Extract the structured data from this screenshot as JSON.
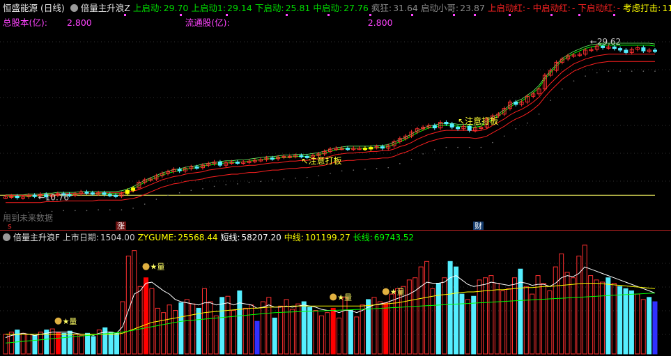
{
  "header": {
    "stock_name": "恒盛能源",
    "period": "(日线)",
    "indicator_name": "倍量主升浪Z",
    "metrics": [
      {
        "label": "上启动:",
        "value": "29.70",
        "color": "#00dd00"
      },
      {
        "label": "上启动1:",
        "value": "29.14",
        "color": "#00dd00"
      },
      {
        "label": "下启动:",
        "value": "25.81",
        "color": "#00dd00"
      },
      {
        "label": "中启动:",
        "value": "27.76",
        "color": "#00dd00"
      },
      {
        "label": "疯狂:",
        "value": "31.64",
        "color": "#8a8a8a"
      },
      {
        "label": "启动小哥:",
        "value": "23.87",
        "color": "#8a8a8a"
      },
      {
        "label": "上启动红:",
        "value": "-",
        "color": "#ff2222"
      },
      {
        "label": "中启动红:",
        "value": "-",
        "color": "#ff2222"
      },
      {
        "label": "下启动红:",
        "value": "-",
        "color": "#ff2222"
      },
      {
        "label": "考虑打击:",
        "value": "11.71",
        "color": "#ffff00"
      }
    ],
    "end_glyph": "◇"
  },
  "info": {
    "total_shares_label": "总股本(亿):",
    "total_shares_value": "2.800",
    "float_shares_label": "流通股(亿):",
    "float_shares_value": "2.800"
  },
  "price_annotations": {
    "high_label": "29.62",
    "low_label": "10.76",
    "signal_1": "注意打板",
    "signal_2": "注意打板",
    "future_data": "用到未来数据",
    "marker_s": "s",
    "marker_zhang": "涨",
    "marker_cai": "财"
  },
  "indicator": {
    "name": "倍量主升浪F",
    "items": [
      {
        "label": "上市日期:",
        "value": "1504.00",
        "color": "#cccccc"
      },
      {
        "label": "ZYGUME:",
        "value": "25568.44",
        "color": "#ffff00"
      },
      {
        "label": "短线:",
        "value": "58207.20",
        "color": "#ffffff"
      },
      {
        "label": "中线:",
        "value": "101199.27",
        "color": "#ffff00"
      },
      {
        "label": "长线:",
        "value": "69743.52",
        "color": "#00ff00"
      }
    ],
    "star_label": "★量"
  },
  "colors": {
    "up": "#ff3030",
    "down": "#55eeff",
    "ma_green": "#00ff00",
    "ma_red": "#ff2020",
    "hline": "#ffff66",
    "big_up": "#ffff00"
  },
  "chart_data": [
    {
      "type": "candlestick",
      "title": "恒盛能源 (日线)",
      "ylim": [
        9.5,
        31.5
      ],
      "hline": 11.2,
      "price_high": 29.62,
      "price_low": 10.76,
      "series": {
        "close": [
          11.0,
          11.1,
          10.9,
          11.0,
          11.2,
          11.1,
          11.3,
          11.0,
          11.2,
          11.4,
          11.3,
          11.2,
          11.4,
          11.6,
          11.5,
          11.4,
          11.5,
          11.3,
          11.2,
          11.1,
          11.4,
          11.8,
          12.1,
          12.8,
          13.1,
          13.2,
          13.6,
          13.9,
          14.1,
          14.4,
          14.2,
          14.5,
          14.7,
          14.6,
          14.9,
          15.1,
          15.3,
          14.9,
          15.2,
          15.3,
          15.2,
          15.3,
          15.4,
          15.5,
          15.6,
          15.8,
          15.7,
          15.9,
          16.0,
          16.0,
          16.1,
          16.0,
          15.9,
          16.1,
          16.3,
          16.6,
          16.9,
          17.0,
          17.0,
          16.9,
          17.0,
          17.0,
          16.9,
          17.1,
          17.2,
          17.0,
          17.3,
          17.8,
          18.2,
          18.5,
          19.0,
          19.4,
          19.6,
          19.8,
          19.5,
          20.2,
          20.0,
          19.6,
          19.4,
          19.7,
          19.2,
          19.5,
          19.6,
          20.6,
          21.0,
          21.2,
          21.9,
          22.7,
          22.4,
          22.7,
          23.4,
          23.7,
          24.3,
          26.0,
          26.6,
          27.6,
          28.0,
          28.4,
          28.5,
          28.6,
          29.1,
          29.2,
          29.6,
          29.4,
          29.5,
          29.3,
          29.1,
          28.8,
          29.2,
          29.4,
          29.0,
          29.1,
          29.0
        ],
        "ma_green_1": [
          11.0,
          11.0,
          11.0,
          11.0,
          11.1,
          11.1,
          11.1,
          11.2,
          11.2,
          11.3,
          11.3,
          11.3,
          11.3,
          11.4,
          11.4,
          11.4,
          11.4,
          11.4,
          11.4,
          11.4,
          11.5,
          11.7,
          12.0,
          12.4,
          12.8,
          13.1,
          13.4,
          13.7,
          13.9,
          14.1,
          14.2,
          14.4,
          14.5,
          14.6,
          14.8,
          14.9,
          15.0,
          15.1,
          15.2,
          15.2,
          15.3,
          15.3,
          15.4,
          15.5,
          15.6,
          15.7,
          15.7,
          15.8,
          15.9,
          15.9,
          16.0,
          16.0,
          16.0,
          16.1,
          16.2,
          16.4,
          16.6,
          16.8,
          16.9,
          17.0,
          17.0,
          17.0,
          17.0,
          17.0,
          17.1,
          17.1,
          17.2,
          17.5,
          17.8,
          18.1,
          18.5,
          18.9,
          19.2,
          19.5,
          19.6,
          19.8,
          19.8,
          19.8,
          19.7,
          19.7,
          19.6,
          19.6,
          19.7,
          20.1,
          20.6,
          21.0,
          21.5,
          22.1,
          22.5,
          22.8,
          23.3,
          23.8,
          24.5,
          25.5,
          26.3,
          27.1,
          27.8,
          28.3,
          28.7,
          29.0,
          29.3,
          29.5,
          29.6,
          29.7,
          29.7,
          29.7,
          29.7,
          29.7,
          29.7,
          29.7,
          29.7,
          29.7,
          29.6
        ],
        "ma_red_low": [
          10.3,
          10.3,
          10.3,
          10.3,
          10.3,
          10.3,
          10.3,
          10.4,
          10.4,
          10.4,
          10.5,
          10.5,
          10.5,
          10.5,
          10.5,
          10.5,
          10.6,
          10.6,
          10.6,
          10.6,
          10.6,
          10.7,
          10.8,
          11.0,
          11.3,
          11.6,
          11.9,
          12.2,
          12.4,
          12.6,
          12.7,
          12.9,
          13.0,
          13.1,
          13.2,
          13.4,
          13.5,
          13.6,
          13.7,
          13.8,
          13.8,
          13.9,
          14.0,
          14.0,
          14.1,
          14.2,
          14.3,
          14.3,
          14.4,
          14.5,
          14.5,
          14.6,
          14.6,
          14.7,
          14.8,
          14.9,
          15.1,
          15.3,
          15.4,
          15.5,
          15.5,
          15.6,
          15.6,
          15.7,
          15.7,
          15.8,
          15.8,
          16.0,
          16.3,
          16.5,
          16.8,
          17.2,
          17.5,
          17.8,
          18.0,
          18.2,
          18.3,
          18.3,
          18.3,
          18.3,
          18.3,
          18.2,
          18.3,
          18.5,
          18.9,
          19.3,
          19.7,
          20.2,
          20.6,
          20.9,
          21.3,
          21.8,
          22.4,
          23.3,
          24.1,
          24.8,
          25.5,
          26.0,
          26.5,
          26.8,
          27.1,
          27.3,
          27.5,
          27.6,
          27.7,
          27.7,
          27.7,
          27.7,
          27.7,
          27.7,
          27.7,
          27.7,
          27.7
        ]
      }
    },
    {
      "type": "bar",
      "title": "倍量主升浪F",
      "ylim": [
        0,
        101199.27
      ],
      "values": [
        18000,
        20000,
        22000,
        19000,
        18000,
        17000,
        20000,
        22000,
        23000,
        20000,
        19000,
        21000,
        18000,
        17000,
        19000,
        16000,
        22000,
        24000,
        20000,
        19000,
        48000,
        90000,
        95000,
        62000,
        70000,
        60000,
        42000,
        38000,
        45000,
        40000,
        47000,
        50000,
        46000,
        42000,
        60000,
        48000,
        35000,
        52000,
        53000,
        40000,
        58000,
        42000,
        45000,
        30000,
        48000,
        52000,
        33000,
        44000,
        50000,
        41000,
        46000,
        48000,
        43000,
        40000,
        35000,
        38000,
        42000,
        33000,
        52000,
        40000,
        34000,
        45000,
        50000,
        52000,
        48000,
        47000,
        55000,
        60000,
        62000,
        68000,
        70000,
        80000,
        85000,
        60000,
        65000,
        70000,
        85000,
        80000,
        55000,
        50000,
        53000,
        68000,
        70000,
        72000,
        65000,
        58000,
        60000,
        70000,
        78000,
        62000,
        55000,
        72000,
        65000,
        58000,
        80000,
        92000,
        75000,
        70000,
        90000,
        100000,
        72000,
        68000,
        66000,
        70000,
        65000,
        62000,
        60000,
        58000,
        55000,
        50000,
        52000,
        48000
      ],
      "short_line": [
        15000,
        17000,
        18000,
        19000,
        18000,
        17000,
        18000,
        19000,
        20000,
        20000,
        20000,
        20000,
        19000,
        18000,
        18000,
        17000,
        19000,
        20000,
        20000,
        19000,
        25000,
        40000,
        55000,
        58000,
        65000,
        66000,
        62000,
        58000,
        55000,
        50000,
        48000,
        47000,
        46000,
        45000,
        47000,
        47000,
        45000,
        46000,
        47000,
        45000,
        47000,
        46000,
        45000,
        42000,
        43000,
        45000,
        43000,
        43000,
        44000,
        43000,
        44000,
        45000,
        44000,
        43000,
        41000,
        40000,
        40000,
        38000,
        40000,
        40000,
        38000,
        40000,
        43000,
        45000,
        46000,
        47000,
        49000,
        51000,
        53000,
        55000,
        58000,
        62000,
        66000,
        65000,
        65000,
        66000,
        70000,
        72000,
        68000,
        64000,
        62000,
        63000,
        64000,
        66000,
        65000,
        64000,
        63000,
        64000,
        66000,
        65000,
        63000,
        64000,
        64000,
        62000,
        65000,
        70000,
        72000,
        71000,
        74000,
        80000,
        78000,
        76000,
        74000,
        72000,
        70000,
        68000,
        66000,
        64000,
        62000,
        60000,
        58000,
        56000
      ],
      "mid_line": [
        18000,
        18000,
        18000,
        18000,
        18000,
        18000,
        18000,
        18000,
        18000,
        18000,
        18000,
        18000,
        18000,
        18000,
        18000,
        18000,
        18000,
        18000,
        18000,
        18000,
        19000,
        21000,
        23000,
        25000,
        27000,
        29000,
        30000,
        31000,
        32000,
        33000,
        34000,
        35000,
        36000,
        37000,
        38000,
        38500,
        39000,
        39500,
        40000,
        40500,
        41000,
        41500,
        42000,
        42000,
        42500,
        43000,
        43000,
        43500,
        43500,
        44000,
        44000,
        44000,
        44000,
        44000,
        44000,
        44000,
        44000,
        44000,
        44000,
        44000,
        44000,
        44000,
        44500,
        45000,
        45500,
        46000,
        46500,
        47000,
        48000,
        49000,
        50000,
        51000,
        52000,
        53000,
        54000,
        54500,
        55000,
        56000,
        56500,
        57000,
        57000,
        57500,
        58000,
        58500,
        59000,
        59000,
        59500,
        60000,
        60500,
        61000,
        61000,
        61500,
        62000,
        62000,
        62500,
        63000,
        63500,
        64000,
        64500,
        65000,
        65000,
        65000,
        64500,
        64000,
        63500,
        63000,
        62500,
        62000,
        61500,
        61000,
        60500,
        60000
      ],
      "long_line": [
        10000,
        10500,
        11000,
        11500,
        12000,
        12500,
        13000,
        13500,
        14000,
        14500,
        15000,
        15500,
        16000,
        16500,
        17000,
        17500,
        18000,
        18500,
        19000,
        19500,
        20000,
        21000,
        22000,
        23000,
        24000,
        25000,
        26000,
        27000,
        28000,
        29000,
        30000,
        30500,
        31000,
        31500,
        32000,
        32500,
        33000,
        33500,
        34000,
        34500,
        35000,
        35500,
        36000,
        36500,
        37000,
        37500,
        38000,
        38200,
        38400,
        38600,
        38800,
        39000,
        39200,
        39400,
        39600,
        39800,
        40000,
        40200,
        40400,
        40600,
        40800,
        41000,
        41300,
        41600,
        41900,
        42200,
        42500,
        42800,
        43100,
        43400,
        43700,
        44000,
        44300,
        44600,
        44900,
        45200,
        45500,
        45800,
        46100,
        46400,
        46700,
        47000,
        47300,
        47600,
        47900,
        48200,
        48500,
        48800,
        49100,
        49400,
        49700,
        50000,
        50300,
        50600,
        50900,
        51200,
        51500,
        51800,
        52100,
        52400,
        52700,
        53000,
        53300,
        53600,
        53900,
        54200,
        54500,
        54800,
        55100,
        55400,
        55700,
        56000
      ]
    }
  ]
}
